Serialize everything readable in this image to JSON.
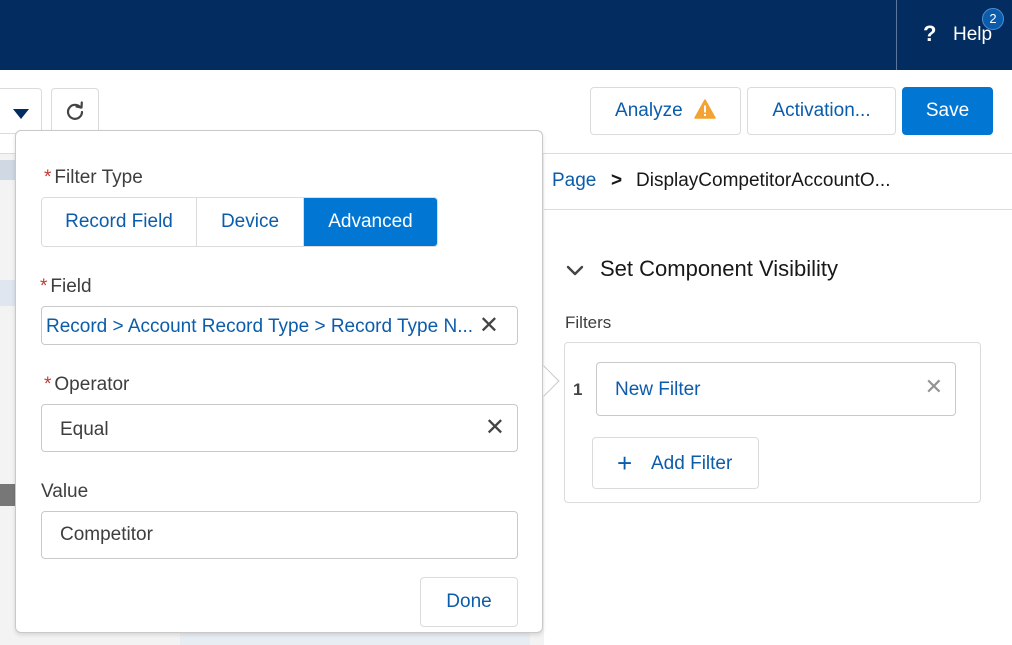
{
  "header": {
    "help_label": "Help",
    "help_badge": "2",
    "help_icon": "question-icon"
  },
  "toolbar": {
    "analyze_label": "Analyze",
    "activation_label": "Activation...",
    "save_label": "Save",
    "refresh_icon": "refresh-icon",
    "dropdown_icon": "caret-down-icon",
    "warning_icon": "warning-icon",
    "warning_color": "#f3a233",
    "save_color": "#0176d3"
  },
  "breadcrumb": {
    "page": "Page",
    "separator": ">",
    "current": "DisplayCompetitorAccountO..."
  },
  "visibility": {
    "title": "Set Component Visibility",
    "filters_label": "Filters",
    "filters": [
      {
        "number": "1",
        "label": "New Filter"
      }
    ],
    "add_filter_label": "Add Filter"
  },
  "popover": {
    "filter_type_label": "Filter Type",
    "filter_types": [
      "Record Field",
      "Device",
      "Advanced"
    ],
    "selected_filter_type": "Advanced",
    "field_label": "Field",
    "field_value": "Record > Account Record Type > Record Type N...",
    "operator_label": "Operator",
    "operator_value": "Equal",
    "value_label": "Value",
    "value_value": "Competitor",
    "done_label": "Done",
    "required_marker": "*"
  }
}
